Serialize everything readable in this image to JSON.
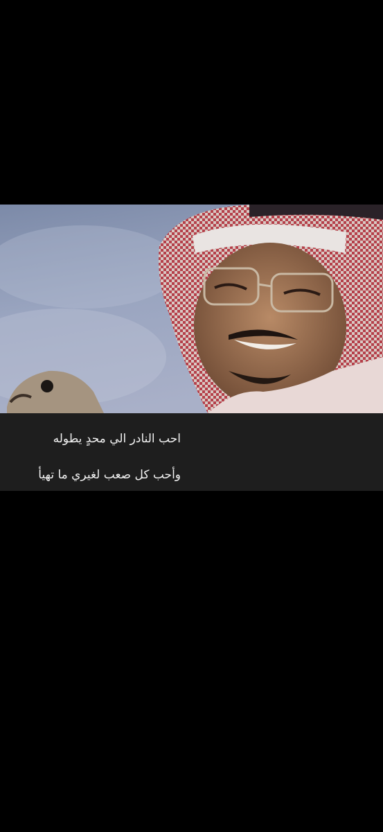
{
  "caption": {
    "line1": "احب النادر الي محدٍ يطوله",
    "line2": "وأحب كل صعب لغيري ما تهيأ"
  },
  "colors": {
    "background": "#000000",
    "caption_bg": "#1e1e1e",
    "caption_text": "#f2f2f2",
    "sky": "#8a93b0",
    "shemagh_red": "#b33a45"
  }
}
